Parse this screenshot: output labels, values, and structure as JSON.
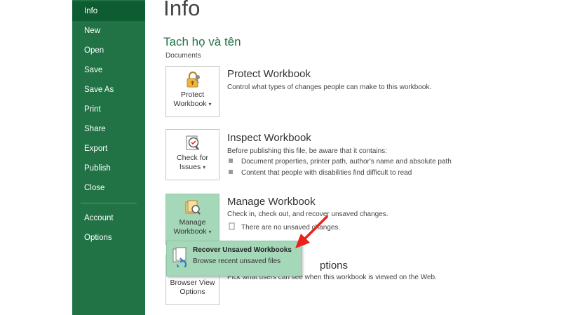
{
  "sidebar": {
    "items": [
      {
        "label": "Info"
      },
      {
        "label": "New"
      },
      {
        "label": "Open"
      },
      {
        "label": "Save"
      },
      {
        "label": "Save As"
      },
      {
        "label": "Print"
      },
      {
        "label": "Share"
      },
      {
        "label": "Export"
      },
      {
        "label": "Publish"
      },
      {
        "label": "Close"
      },
      {
        "label": "Account"
      },
      {
        "label": "Options"
      }
    ]
  },
  "main": {
    "title": "Info",
    "document_name": "Tach họ và tên",
    "location": "Documents",
    "protect": {
      "tile_line1": "Protect",
      "tile_line2": "Workbook",
      "title": "Protect Workbook",
      "description": "Control what types of changes people can make to this workbook."
    },
    "inspect": {
      "tile_line1": "Check for",
      "tile_line2": "Issues",
      "title": "Inspect Workbook",
      "description": "Before publishing this file, be aware that it contains:",
      "bullets": [
        "Document properties, printer path, author's name and absolute path",
        "Content that people with disabilities find difficult to read"
      ]
    },
    "manage": {
      "tile_line1": "Manage",
      "tile_line2": "Workbook",
      "title": "Manage Workbook",
      "description": "Check in, check out, and recover unsaved changes.",
      "status": "There are no unsaved changes."
    },
    "browser": {
      "tile_line1": "Browser View",
      "tile_line2": "Options",
      "title_partial": "ptions",
      "description": "Pick what users can see when this workbook is viewed on the Web."
    }
  },
  "popup": {
    "title": "Recover Unsaved Workbooks",
    "subtitle": "Browse recent unsaved files"
  },
  "colors": {
    "sidebar_bg": "#217346",
    "sidebar_active": "#0e5c32",
    "accent_green": "#217346",
    "selected_tile": "#a5d7b9",
    "annotation_arrow": "#e8231d"
  }
}
